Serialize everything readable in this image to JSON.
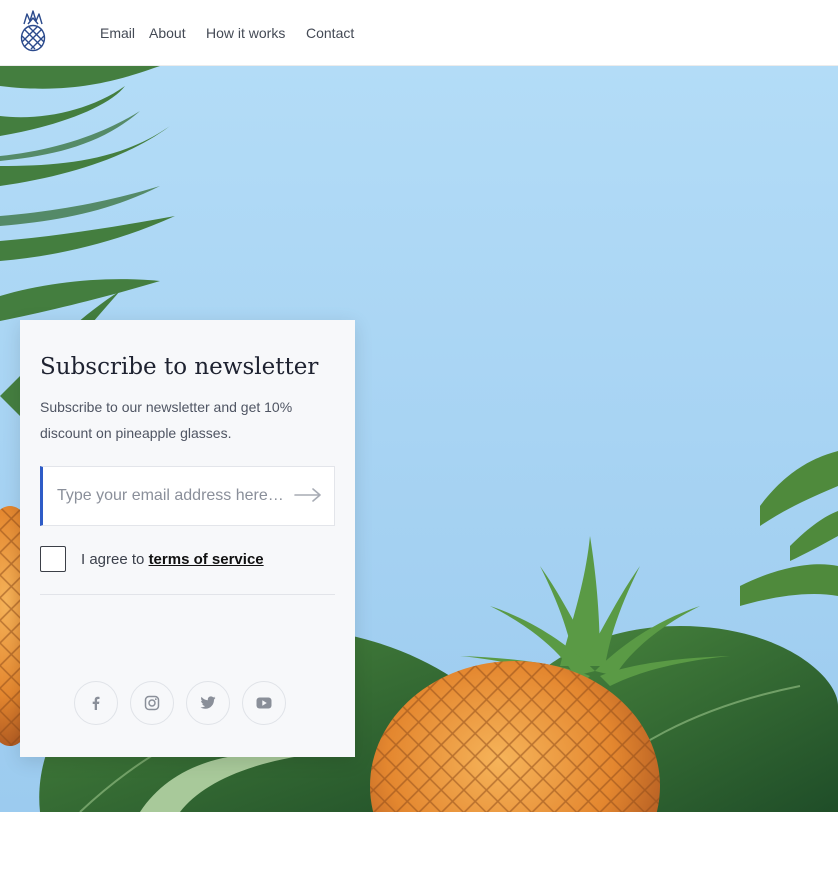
{
  "nav": {
    "links": [
      {
        "label": "Email"
      },
      {
        "label": "About"
      },
      {
        "label": "How it works"
      },
      {
        "label": "Contact"
      }
    ]
  },
  "newsletter": {
    "title": "Subscribe to newsletter",
    "description": "Subscribe to our newsletter and get 10% discount on pineapple glasses.",
    "email_placeholder": "Type your email address here…",
    "email_value": "",
    "agree_prefix": "I agree to",
    "terms_link": "terms of service",
    "agreed": false
  },
  "social": [
    {
      "network": "facebook",
      "icon": "facebook-icon"
    },
    {
      "network": "instagram",
      "icon": "instagram-icon"
    },
    {
      "network": "twitter",
      "icon": "twitter-icon"
    },
    {
      "network": "youtube",
      "icon": "youtube-icon"
    }
  ],
  "colors": {
    "accent": "#2e5cc7",
    "hero_sky": "#a7d3f4",
    "logo": "#2b4a8c"
  }
}
